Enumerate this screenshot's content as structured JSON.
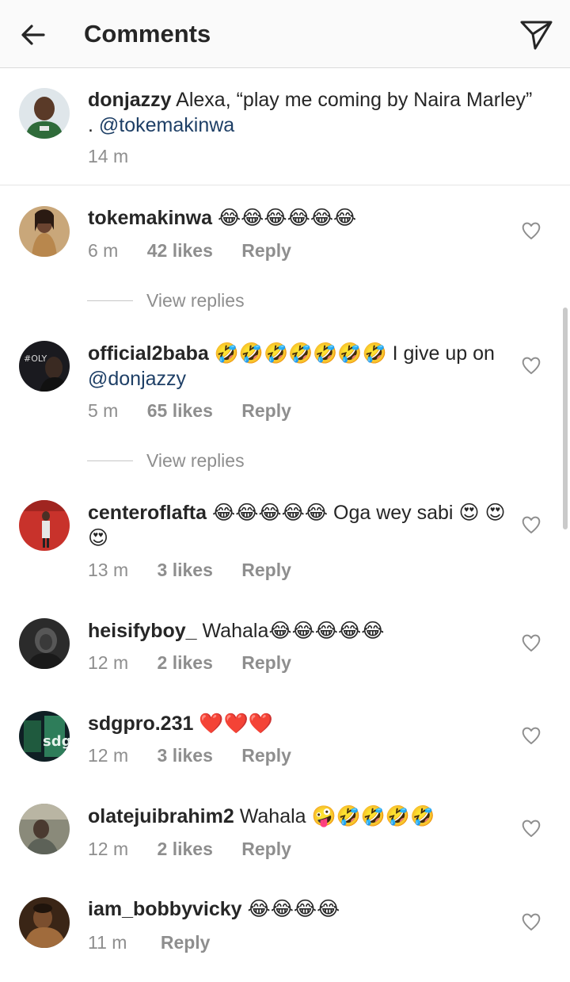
{
  "header": {
    "title": "Comments",
    "back_icon": "arrow-left-icon",
    "send_icon": "direct-send-icon"
  },
  "caption": {
    "username": "donjazzy",
    "text": "Alexa, “play me coming by Naira Marley” .",
    "mention": "@tokemakinwa",
    "time": "14 m"
  },
  "comments": [
    {
      "username": "tokemakinwa",
      "text": "",
      "emoji": "😂😂😂😂😂😂",
      "time": "6 m",
      "likes": "42 likes",
      "reply": "Reply",
      "view_replies": "View replies"
    },
    {
      "username": "official2baba",
      "emoji": "🤣🤣🤣🤣🤣🤣🤣",
      "text": "I give up on",
      "mention": "@donjazzy",
      "time": "5 m",
      "likes": "65 likes",
      "reply": "Reply",
      "view_replies": "View replies"
    },
    {
      "username": "centeroflafta",
      "emoji": "😂😂😂😂😂",
      "text": "Oga wey sabi",
      "emoji2": "😍",
      "emoji3": "😍😍",
      "time": "13 m",
      "likes": "3 likes",
      "reply": "Reply"
    },
    {
      "username": "heisifyboy_",
      "text": "Wahala",
      "emoji": "😂😂😂😂😂",
      "time": "12 m",
      "likes": "2 likes",
      "reply": "Reply"
    },
    {
      "username": "sdgpro.231",
      "emoji": "❤️❤️❤️",
      "time": "12 m",
      "likes": "3 likes",
      "reply": "Reply"
    },
    {
      "username": "olatejuibrahim2",
      "text": "Wahala",
      "emoji": "🤪🤣🤣🤣🤣",
      "time": "12 m",
      "likes": "2 likes",
      "reply": "Reply"
    },
    {
      "username": "iam_bobbyvicky",
      "emoji": "😂😂😂😂",
      "time": "11 m",
      "reply": "Reply"
    }
  ],
  "colors": {
    "mention": "#1e3f66",
    "meta": "#8e8e8e",
    "text": "#262626"
  }
}
